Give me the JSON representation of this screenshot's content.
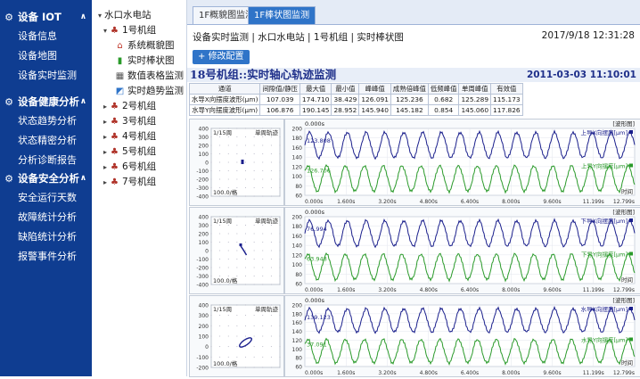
{
  "sidebar": {
    "sections": [
      {
        "title": "设备 IOT",
        "items": [
          "设备信息",
          "设备地图",
          "设备实时监测"
        ]
      },
      {
        "title": "设备健康分析",
        "items": [
          "状态趋势分析",
          "状态精密分析",
          "分析诊断报告"
        ]
      },
      {
        "title": "设备安全分析",
        "items": [
          "安全运行天数",
          "故障统计分析",
          "缺陷统计分析",
          "报警事件分析"
        ]
      }
    ]
  },
  "tree": {
    "root": "水口水电站",
    "unit1": "1号机组",
    "unit1_children": [
      "系统概貌图",
      "实时棒状图",
      "数值表格监测",
      "实时趋势监测"
    ],
    "units": [
      "2号机组",
      "3号机组",
      "4号机组",
      "5号机组",
      "6号机组",
      "7号机组"
    ]
  },
  "tabs": [
    "1F概貌图监测",
    "1F棒状图监测"
  ],
  "breadcrumb": "设备实时监测 | 水口水电站 | 1号机组 | 实时棒状图",
  "datetime": "2017/9/18 12:31:28",
  "modify_button": "修改配置",
  "panel": {
    "title": "18号机组::实时轴心轨迹监测",
    "timestamp": "2011-03-03 11:10:01",
    "table": {
      "headers": [
        "通道",
        "间隙值/静压",
        "最大值",
        "最小值",
        "峰峰值",
        "成熟倍峰值",
        "低频峰值",
        "单周峰值",
        "有效值"
      ],
      "rows": [
        [
          "水导X向摆度波形(μm)",
          "107.039",
          "174.710",
          "38.429",
          "126.091",
          "125.236",
          "0.682",
          "125.289",
          "115.173"
        ],
        [
          "水导Y向摆度波形(μm)",
          "106.876",
          "190.145",
          "28.952",
          "145.940",
          "145.182",
          "0.854",
          "145.060",
          "117.826"
        ]
      ]
    },
    "orbits": [
      {
        "label": "1/15周",
        "mode": "单周轨迹",
        "scale": "100.0/格",
        "yticks": [
          "400",
          "300",
          "200",
          "100",
          "0",
          "-100",
          "-200",
          "-300",
          "-400"
        ]
      },
      {
        "label": "1/15周",
        "mode": "单周轨迹",
        "scale": "100.0/格",
        "yticks": [
          "400",
          "300",
          "200",
          "100",
          "0",
          "-100",
          "-200",
          "-300",
          "-400"
        ]
      },
      {
        "label": "1/15周",
        "mode": "单周轨迹",
        "scale": "100.0/格",
        "yticks": [
          "400",
          "300",
          "200",
          "100",
          "0",
          "-100",
          "-200"
        ]
      }
    ],
    "trends": [
      {
        "tag": "[波形图]",
        "start": "0.000s",
        "yticks": [
          "200",
          "180",
          "160",
          "140",
          "120",
          "100",
          "80",
          "60"
        ],
        "series": [
          {
            "name": "上导X向摆度[μm]",
            "value": "123.808",
            "color": "#1a1f8c"
          },
          {
            "name": "上导Y向摆度[μm]",
            "value": "126.706",
            "color": "#2a9a2a"
          }
        ],
        "xticks": [
          "0.000s",
          "1.600s",
          "3.200s",
          "4.800s",
          "6.400s",
          "8.000s",
          "9.600s",
          "11.199s",
          "12.799s"
        ],
        "xlabel": "时间"
      },
      {
        "tag": "[波形图]",
        "start": "0.000s",
        "yticks": [
          "200",
          "180",
          "160",
          "140",
          "120",
          "100",
          "80",
          "60"
        ],
        "series": [
          {
            "name": "下导X向摆度[μm]",
            "value": "76.994",
            "color": "#1a1f8c"
          },
          {
            "name": "下导Y向摆度[μm]",
            "value": "63.948",
            "color": "#2a9a2a"
          }
        ],
        "xticks": [
          "0.000s",
          "1.600s",
          "3.200s",
          "4.800s",
          "6.400s",
          "8.000s",
          "9.600s",
          "11.199s",
          "12.799s"
        ],
        "xlabel": "时间"
      },
      {
        "tag": "[波形图]",
        "start": "0.000s",
        "yticks": [
          "200",
          "180",
          "160",
          "140",
          "120",
          "100",
          "80",
          "60"
        ],
        "series": [
          {
            "name": "水导X向摆度[μm]",
            "value": "139.123",
            "color": "#1a1f8c"
          },
          {
            "name": "水导Y向摆度[μm]",
            "value": "37.091",
            "color": "#2a9a2a"
          }
        ],
        "xticks": [
          "0.000s",
          "1.600s",
          "3.200s",
          "4.800s",
          "6.400s",
          "8.000s",
          "9.600s",
          "11.199s",
          "12.799s"
        ],
        "xlabel": "时间"
      }
    ]
  },
  "colors": {
    "sidebar": "#0f3d91",
    "accent": "#2f74c8",
    "title": "#1e2f8a",
    "series1": "#1a1f8c",
    "series2": "#2a9a2a"
  }
}
